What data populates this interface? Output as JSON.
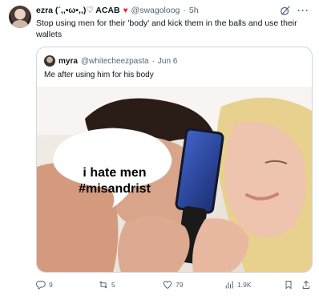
{
  "tweet": {
    "author_name": "ezra (´,,•ω•,,)♡ ACAB",
    "heart": "♥",
    "handle": "@swagoloog",
    "separator": "·",
    "time": "5h",
    "text": "Stop using men for their 'body' and kick them in the balls and use their wallets",
    "more": "···"
  },
  "quote": {
    "author_name": "myra",
    "handle": "@whitecheezpasta",
    "separator": "·",
    "time": "Jun 6",
    "text": "Me after using him for his body",
    "meme_text": "i hate men\n#misandrist"
  },
  "actions": {
    "replies": "9",
    "reposts": "5",
    "likes": "79",
    "views": "1.9K"
  },
  "colors": {
    "text": "#0f1419",
    "muted": "#536471",
    "border": "#cfd9de",
    "heart": "#f4212e"
  }
}
